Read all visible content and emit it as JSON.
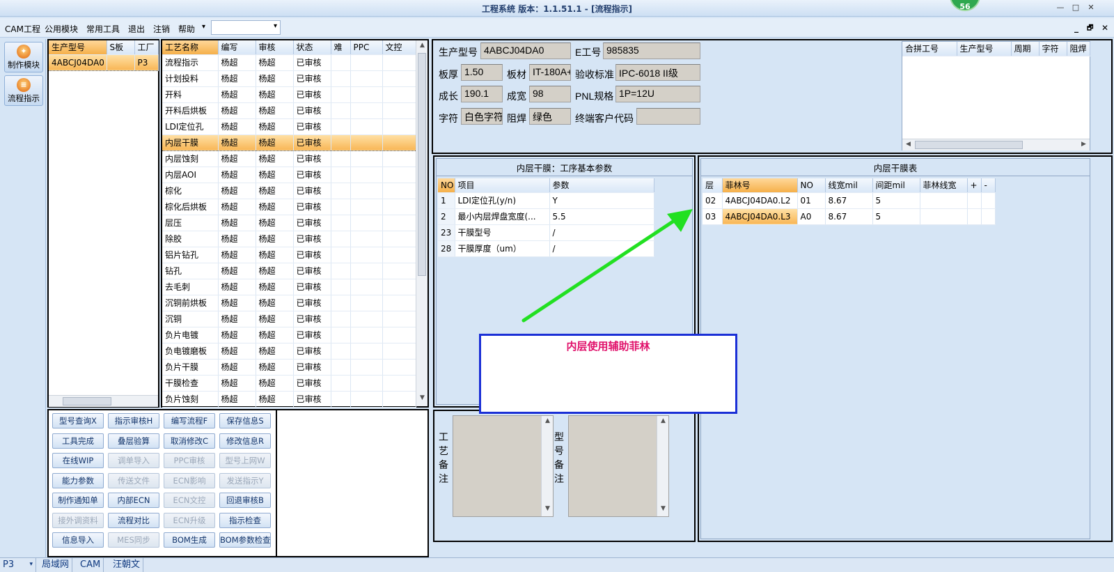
{
  "window": {
    "title": "工程系统   版本：1.1.51.1 - [流程指示]",
    "badge": "56",
    "controls": [
      "—",
      "□",
      "✕"
    ]
  },
  "menu": {
    "items": [
      "CAM工程",
      "公用模块",
      "常用工具",
      "退出",
      "注销",
      "帮助",
      "▾"
    ],
    "combo_value": "",
    "mdi_controls": [
      "_",
      "🗗",
      "✕"
    ]
  },
  "rail": {
    "buttons": [
      "制作模块",
      "流程指示"
    ]
  },
  "model_list": {
    "headers": [
      "生产型号",
      "S板",
      "工厂"
    ],
    "rows": [
      [
        "4ABCJ04DA0",
        "",
        "P3"
      ]
    ]
  },
  "process_list": {
    "headers": [
      "工艺名称",
      "编写",
      "审核",
      "状态",
      "难",
      "PPC",
      "文控"
    ],
    "rows": [
      [
        "流程指示",
        "杨超",
        "杨超",
        "已审核"
      ],
      [
        "计划投料",
        "杨超",
        "杨超",
        "已审核"
      ],
      [
        "开料",
        "杨超",
        "杨超",
        "已审核"
      ],
      [
        "开料后烘板",
        "杨超",
        "杨超",
        "已审核"
      ],
      [
        "LDI定位孔",
        "杨超",
        "杨超",
        "已审核"
      ],
      [
        "内层干膜",
        "杨超",
        "杨超",
        "已审核"
      ],
      [
        "内层蚀刻",
        "杨超",
        "杨超",
        "已审核"
      ],
      [
        "内层AOI",
        "杨超",
        "杨超",
        "已审核"
      ],
      [
        "棕化",
        "杨超",
        "杨超",
        "已审核"
      ],
      [
        "棕化后烘板",
        "杨超",
        "杨超",
        "已审核"
      ],
      [
        "层压",
        "杨超",
        "杨超",
        "已审核"
      ],
      [
        "除胶",
        "杨超",
        "杨超",
        "已审核"
      ],
      [
        "铝片钻孔",
        "杨超",
        "杨超",
        "已审核"
      ],
      [
        "钻孔",
        "杨超",
        "杨超",
        "已审核"
      ],
      [
        "去毛刺",
        "杨超",
        "杨超",
        "已审核"
      ],
      [
        "沉铜前烘板",
        "杨超",
        "杨超",
        "已审核"
      ],
      [
        "沉铜",
        "杨超",
        "杨超",
        "已审核"
      ],
      [
        "负片电镀",
        "杨超",
        "杨超",
        "已审核"
      ],
      [
        "负电镀磨板",
        "杨超",
        "杨超",
        "已审核"
      ],
      [
        "负片干膜",
        "杨超",
        "杨超",
        "已审核"
      ],
      [
        "干膜检查",
        "杨超",
        "杨超",
        "已审核"
      ],
      [
        "负片蚀刻",
        "杨超",
        "杨超",
        "已审核"
      ]
    ],
    "selected_index": 5
  },
  "buttons": [
    [
      "型号查询X",
      "指示审核H",
      "编写流程F",
      "保存信息S"
    ],
    [
      "工具完成",
      "叠层验算",
      "取消修改C",
      "修改信息R"
    ],
    [
      "在线WIP",
      "调单导入",
      "PPC审核",
      "型号上网W"
    ],
    [
      "能力参数",
      "传送文件",
      "ECN影响",
      "发送指示Y"
    ],
    [
      "制作通知单",
      "内部ECN",
      "ECN文控",
      "回退审核B"
    ],
    [
      "接外调资料",
      "流程对比",
      "ECN升级",
      "指示检查"
    ],
    [
      "信息导入",
      "MES同步",
      "BOM生成",
      "BOM参数检查"
    ]
  ],
  "disabled_buttons": [
    "调单导入",
    "PPC审核",
    "型号上网W",
    "传送文件",
    "ECN影响",
    "发送指示Y",
    "ECN文控",
    "接外调资料",
    "ECN升级",
    "MES同步"
  ],
  "info": {
    "model_label": "生产型号",
    "model_value": "4ABCJ04DA0",
    "e_label": "E工号",
    "e_value": "985835",
    "thick_label": "板厚",
    "thick_value": "1.50",
    "material_label": "板材",
    "material_value": "IT-180A+",
    "std_label": "验收标准",
    "std_value": "IPC-6018 II级",
    "len_label": "成长",
    "len_value": "190.1",
    "wid_label": "成宽",
    "wid_value": "98",
    "pnl_label": "PNL规格",
    "pnl_value": "1P=12U",
    "char_label": "字符",
    "char_value": "白色字符",
    "mask_label": "阻焊",
    "mask_value": "绿色",
    "cust_label": "终端客户代码",
    "cust_value": ""
  },
  "merge_table": {
    "headers": [
      "合拼工号",
      "生产型号",
      "周期",
      "字符",
      "阻焊"
    ]
  },
  "params_panel": {
    "title": "内层干膜：工序基本参数",
    "headers": [
      "NO",
      "项目",
      "参数"
    ],
    "rows": [
      [
        "1",
        "LDI定位孔(y/n)",
        "Y"
      ],
      [
        "2",
        "最小内层焊盘宽度(...",
        "5.5"
      ],
      [
        "23",
        "干膜型号",
        "/"
      ],
      [
        "28",
        "干膜厚度（um）",
        "/"
      ]
    ]
  },
  "film_panel": {
    "title": "内层干膜表",
    "headers": [
      "层",
      "菲林号",
      "NO",
      "线宽mil",
      "间距mil",
      "菲林线宽",
      "+",
      "-"
    ],
    "rows": [
      [
        "02",
        "4ABCJ04DA0.L2",
        "01",
        "8.67",
        "5",
        "",
        "",
        ""
      ],
      [
        "03",
        "4ABCJ04DA0.L3",
        "A0",
        "8.67",
        "5",
        "",
        "",
        ""
      ]
    ]
  },
  "annotation": {
    "text": "内层使用辅助菲林",
    "arrow_color": "#22e022",
    "text_color": "#e0106a",
    "box_color": "#1a2fd6"
  },
  "notes": {
    "process_label": "工艺备注",
    "model_label": "型号备注"
  },
  "status": {
    "items": [
      "P3",
      "局域网",
      "CAM",
      "汪朝文"
    ]
  }
}
